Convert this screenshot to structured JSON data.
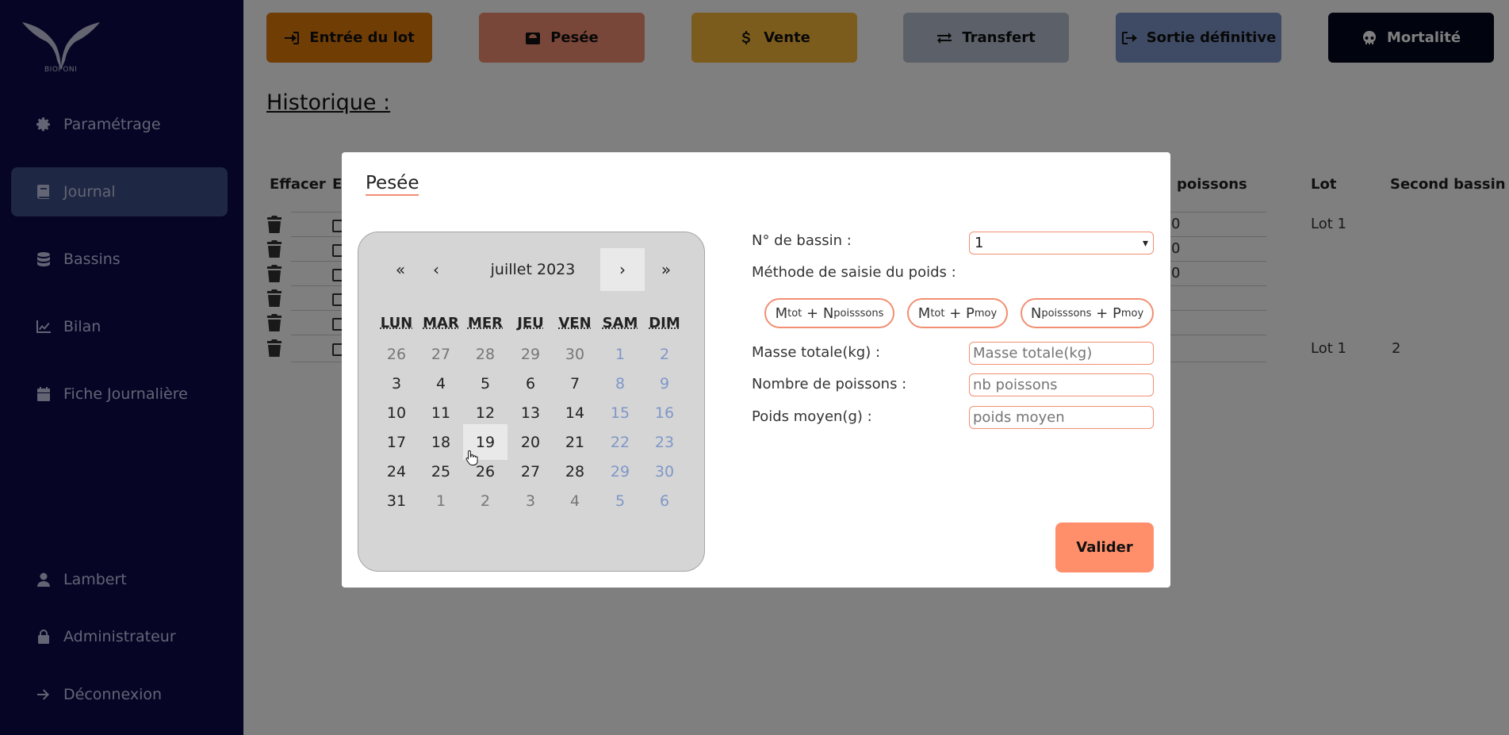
{
  "app": {
    "logo_text": "BIOPONI"
  },
  "sidebar": {
    "items": [
      {
        "label": "Paramétrage",
        "icon": "gear-icon"
      },
      {
        "label": "Journal",
        "icon": "book-icon"
      },
      {
        "label": "Bassins",
        "icon": "database-icon"
      },
      {
        "label": "Bilan",
        "icon": "chart-line-icon"
      },
      {
        "label": "Fiche Journalière",
        "icon": "calendar-icon"
      }
    ],
    "bottom_items": [
      {
        "label": "Lambert",
        "icon": "user-icon"
      },
      {
        "label": "Administrateur",
        "icon": "lock-icon"
      },
      {
        "label": "Déconnexion",
        "icon": "arrow-right-icon"
      }
    ]
  },
  "toolbar": {
    "entree": "Entrée du lot",
    "pesee": "Pesée",
    "vente": "Vente",
    "transfert": "Transfert",
    "sortie": "Sortie définitive",
    "mortalite": "Mortalité"
  },
  "history": {
    "title": "Historique :",
    "headers": {
      "effacer": "Effacer",
      "e": "E",
      "poissons": "poissons",
      "lot": "Lot",
      "second_bassin": "Second bassin"
    },
    "cells": {
      "r1_poissons": "0",
      "r1_lot": "Lot 1",
      "r2_poissons": "0",
      "r3_poissons": "0",
      "r6_lot": "Lot 1",
      "r6_second": "2"
    }
  },
  "modal": {
    "title": "Pesée",
    "calendar": {
      "month_label": "juillet 2023",
      "nav": {
        "prev_year": "«",
        "prev": "‹",
        "next": "›",
        "next_year": "»"
      },
      "weekdays": [
        "LUN",
        "MAR",
        "MER",
        "JEU",
        "VEN",
        "SAM",
        "DIM"
      ],
      "weeks": [
        [
          "26",
          "27",
          "28",
          "29",
          "30",
          "1",
          "2"
        ],
        [
          "3",
          "4",
          "5",
          "6",
          "7",
          "8",
          "9"
        ],
        [
          "10",
          "11",
          "12",
          "13",
          "14",
          "15",
          "16"
        ],
        [
          "17",
          "18",
          "19",
          "20",
          "21",
          "22",
          "23"
        ],
        [
          "24",
          "25",
          "26",
          "27",
          "28",
          "29",
          "30"
        ],
        [
          "31",
          "1",
          "2",
          "3",
          "4",
          "5",
          "6"
        ]
      ]
    },
    "form": {
      "bassin_label": "N° de bassin :",
      "bassin_value": "1",
      "methode_label": "Méthode de saisie du poids :",
      "method1": {
        "a": "M",
        "a_sub": "tot",
        "plus": " + ",
        "b": "N",
        "b_sub": "poisssons"
      },
      "method2": {
        "a": "M",
        "a_sub": "tot",
        "plus": " + ",
        "b": "P",
        "b_sub": "moy"
      },
      "method3": {
        "a": "N",
        "a_sub": "poisssons",
        "plus": " + ",
        "b": "P",
        "b_sub": "moy"
      },
      "masse_label": "Masse totale(kg) :",
      "masse_placeholder": "Masse totale(kg)",
      "nombre_label": "Nombre de poissons :",
      "nombre_placeholder": "nb poissons",
      "poids_label": "Poids moyen(g) :",
      "poids_placeholder": "poids moyen",
      "valider": "Valider"
    }
  }
}
